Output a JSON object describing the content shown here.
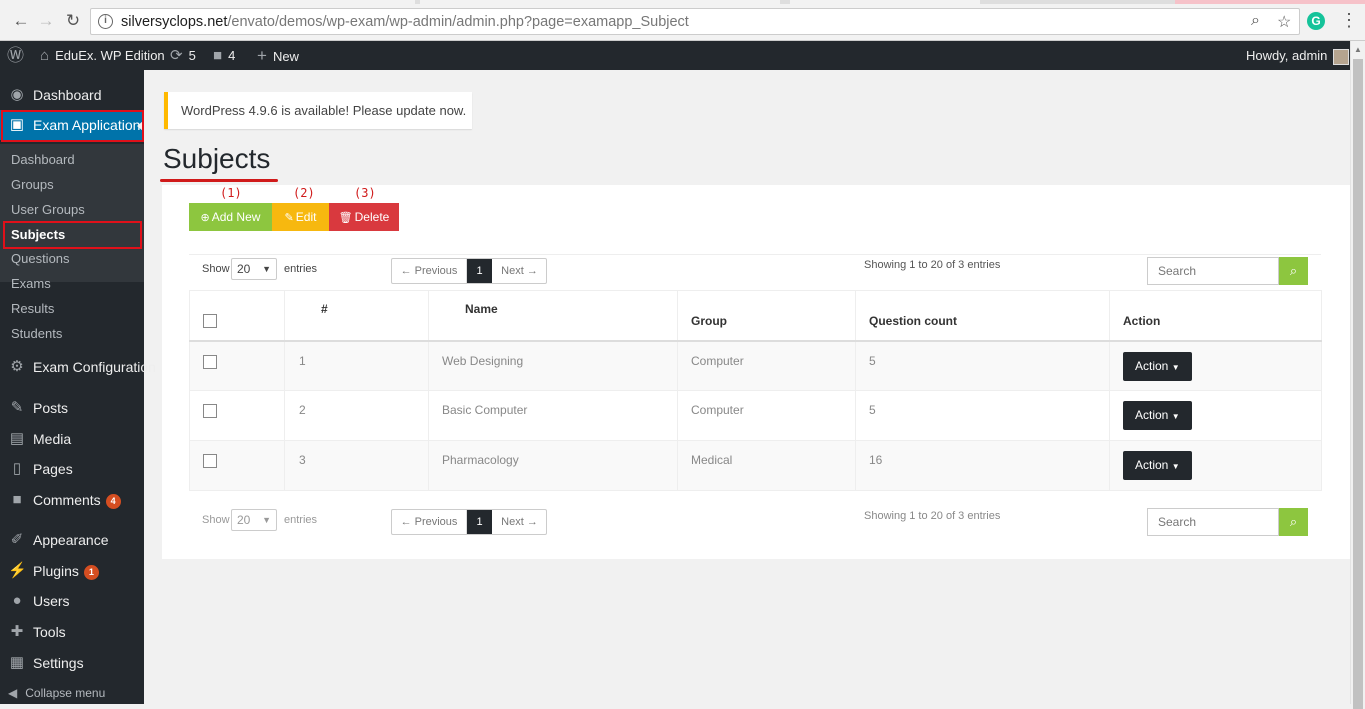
{
  "browser": {
    "url_host": "silversyclops.net",
    "url_path": "/envato/demos/wp-exam/wp-admin/admin.php?page=examapp_Subject"
  },
  "adminbar": {
    "site_name": "EduEx. WP Edition",
    "updates_count": "5",
    "comments_count": "4",
    "new_label": "New",
    "howdy": "Howdy, admin"
  },
  "sidebar": {
    "dashboard": "Dashboard",
    "exam_application": "Exam Application",
    "submenu": [
      "Dashboard",
      "Groups",
      "User Groups",
      "Subjects",
      "Questions",
      "Exams",
      "Results",
      "Students"
    ],
    "exam_configuration": "Exam Configuration",
    "posts": "Posts",
    "media": "Media",
    "pages": "Pages",
    "comments": "Comments",
    "comments_badge": "4",
    "appearance": "Appearance",
    "plugins": "Plugins",
    "plugins_badge": "1",
    "users": "Users",
    "tools": "Tools",
    "settings": "Settings",
    "collapse": "Collapse menu"
  },
  "notice": "WordPress 4.9.6 is available! Please update now.",
  "page_title": "Subjects",
  "annotations": [
    "(1)",
    "(2)",
    "(3)"
  ],
  "toolbar": {
    "add_new": "Add New",
    "edit": "Edit",
    "delete": "Delete"
  },
  "controls": {
    "show_label": "Show",
    "page_size": "20",
    "entries_label": "entries",
    "prev": "← Previous",
    "page": "1",
    "next": "Next →",
    "showing": "Showing 1 to 20 of 3 entries",
    "search_placeholder": "Search"
  },
  "table": {
    "headers": [
      "#",
      "Name",
      "Group",
      "Question count",
      "Action"
    ],
    "rows": [
      {
        "num": "1",
        "name": "Web Designing",
        "group": "Computer",
        "count": "5",
        "action": "Action"
      },
      {
        "num": "2",
        "name": "Basic Computer",
        "group": "Computer",
        "count": "5",
        "action": "Action"
      },
      {
        "num": "3",
        "name": "Pharmacology",
        "group": "Medical",
        "count": "16",
        "action": "Action"
      }
    ]
  },
  "colors": {
    "active_menu": "#0073aa",
    "add_new": "#8dc63f",
    "edit": "#f7b80f",
    "delete": "#d9393e",
    "highlight": "#e0101a"
  }
}
